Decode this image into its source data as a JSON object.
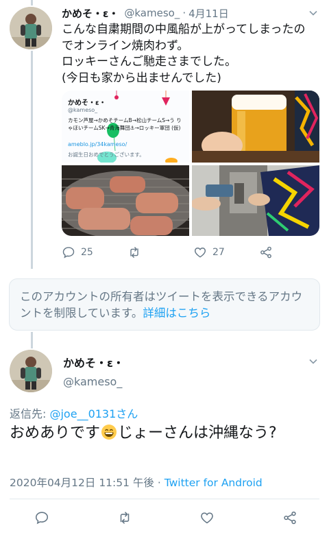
{
  "tweet1": {
    "display_name": "かめそ・ε・",
    "handle": "@kameso_",
    "separator": "·",
    "date": "4月11日",
    "text_lines": [
      "こんな自粛期間の中風船が上がってしまったの",
      "でオンライン焼肉わず。",
      "ロッキーさんご馳走さまでした。",
      "(今日も家から出ませんでした)"
    ],
    "media": {
      "profile_card": {
        "name": "かめそ・ε・",
        "handle": "@kameso_",
        "bio": "カモン芦屋→かめそチームB→松山チームS→う りゃほいチームSK→青海舞団⚓→ロッキー軍団 (仮)",
        "link": "ameblo.jp/34kameso/",
        "birthday_note": "お誕生日おめでとうございます。"
      }
    },
    "actions": {
      "reply_count": "25",
      "like_count": "27"
    }
  },
  "notice": {
    "text": "このアカウントの所有者はツイートを表示できるアカウントを制限しています。",
    "link_label": "詳細はこちら"
  },
  "tweet2": {
    "display_name": "かめそ・ε・",
    "handle": "@kameso_",
    "reply_prefix": "返信先: ",
    "reply_to": "@joe__0131さん",
    "text_before_emoji": "おめありです",
    "text_after_emoji": "じょーさんは沖縄なう?",
    "timestamp": "2020年04月12日 11:51 午後",
    "meta_separator": " · ",
    "client": "Twitter for Android"
  },
  "icons": {
    "reply": "reply-icon",
    "retweet": "retweet-icon",
    "like": "heart-icon",
    "share": "share-icon",
    "more": "chevron-down-icon",
    "emoji": "grinning-face-emoji"
  },
  "colors": {
    "accent": "#1da1f2",
    "secondary_text": "#657786",
    "thread_line": "#ccd6dd",
    "notice_bg": "#f5f8fa"
  }
}
